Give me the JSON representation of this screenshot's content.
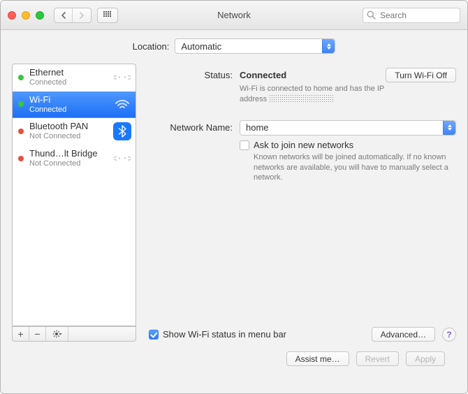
{
  "window": {
    "title": "Network",
    "search_placeholder": "Search"
  },
  "location": {
    "label": "Location:",
    "value": "Automatic"
  },
  "services": [
    {
      "name": "Ethernet",
      "status": "Connected",
      "dot": "green",
      "icon": "ethernet-icon",
      "selected": false
    },
    {
      "name": "Wi-Fi",
      "status": "Connected",
      "dot": "green",
      "icon": "wifi-icon",
      "selected": true
    },
    {
      "name": "Bluetooth PAN",
      "status": "Not Connected",
      "dot": "red",
      "icon": "bluetooth-icon",
      "selected": false
    },
    {
      "name": "Thund…lt Bridge",
      "status": "Not Connected",
      "dot": "red",
      "icon": "thunderbolt-icon",
      "selected": false
    }
  ],
  "detail": {
    "status_label": "Status:",
    "status_value": "Connected",
    "toggle_label": "Turn Wi-Fi Off",
    "status_line1": "Wi-Fi is connected to home and has the IP",
    "status_line2_prefix": "address",
    "network_label": "Network Name:",
    "network_value": "home",
    "ask_label": "Ask to join new networks",
    "ask_checked": false,
    "ask_help": "Known networks will be joined automatically. If no known networks are available, you will have to manually select a network.",
    "show_status_label": "Show Wi-Fi status in menu bar",
    "show_status_checked": true,
    "advanced_label": "Advanced…"
  },
  "footer": {
    "assist": "Assist me…",
    "revert": "Revert",
    "apply": "Apply"
  }
}
